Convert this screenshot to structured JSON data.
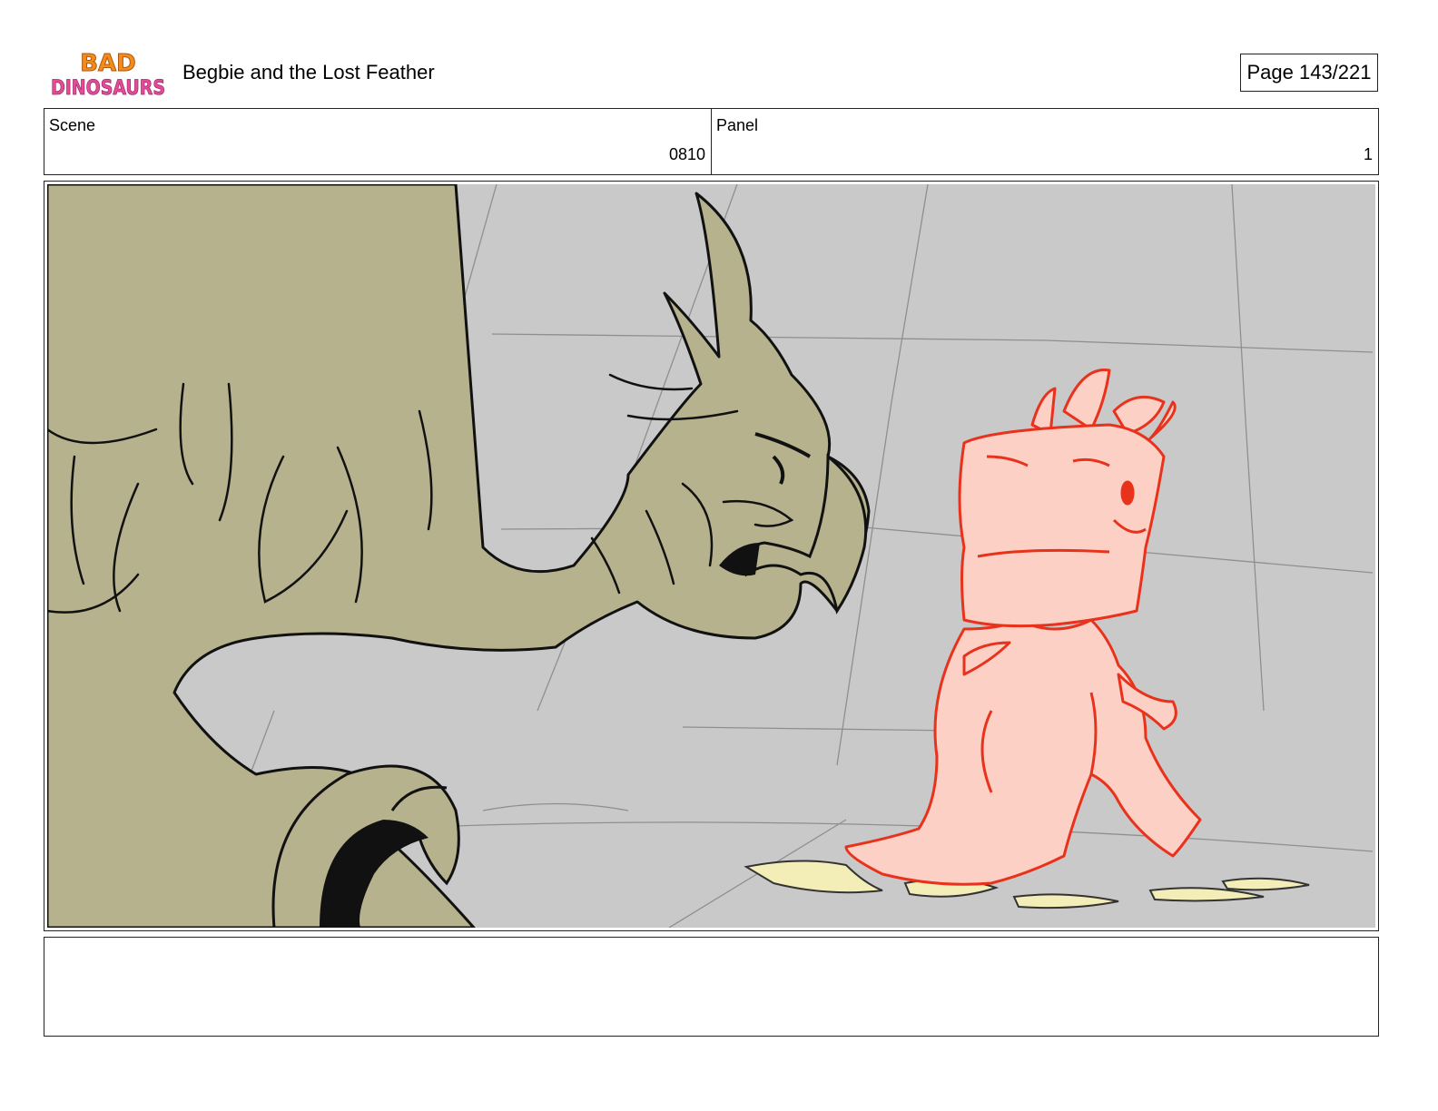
{
  "header": {
    "logo": {
      "line1": "BAD",
      "line2": "DINOSAURS"
    },
    "title": "Begbie and the Lost Feather",
    "page_label": "Page 143/221"
  },
  "scene": {
    "label": "Scene",
    "value": "0810"
  },
  "panel": {
    "label": "Panel",
    "value": "1"
  },
  "notes": {
    "text": ""
  },
  "colors": {
    "background": "#c9c9c9",
    "griffin_fill": "#b6b28e",
    "begbie_fill": "#fdd0c6",
    "begbie_line": "#e8321c",
    "feathers": "#f3edb8"
  }
}
